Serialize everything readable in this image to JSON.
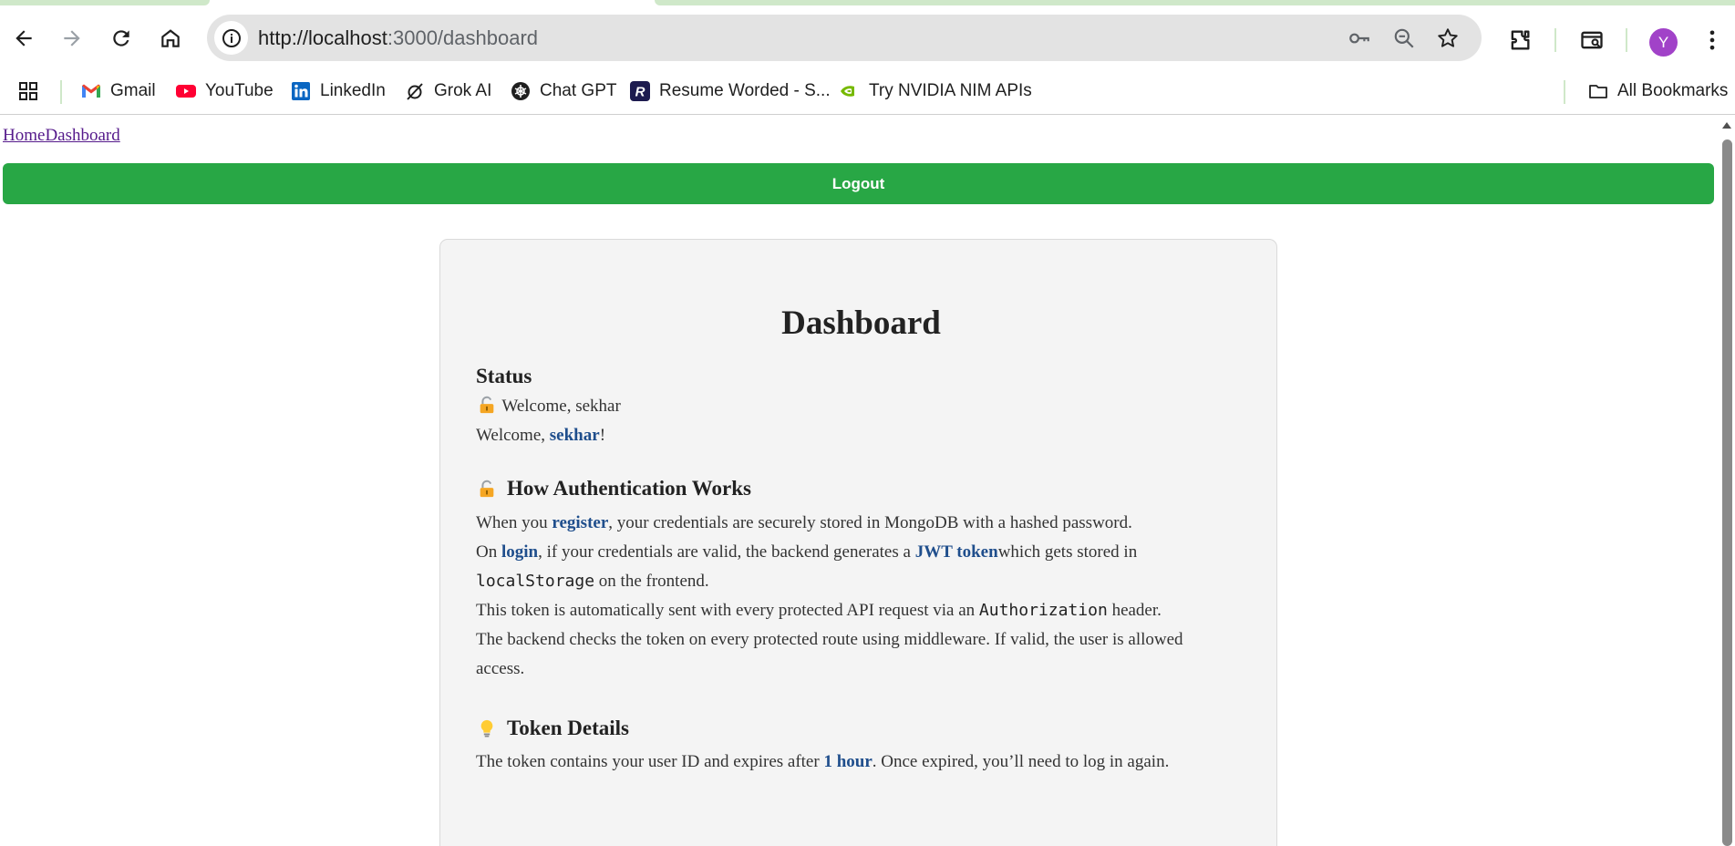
{
  "browser": {
    "url_host": "http://localhost",
    "url_path": ":3000/dashboard",
    "avatar_letter": "Y",
    "accent_color": "#cfe8c9",
    "avatar_color": "#a142c8"
  },
  "bookmarks": {
    "items": [
      {
        "label": "Gmail",
        "icon": "gmail-icon"
      },
      {
        "label": "YouTube",
        "icon": "youtube-icon"
      },
      {
        "label": "LinkedIn",
        "icon": "linkedin-icon"
      },
      {
        "label": "Grok AI",
        "icon": "grok-icon"
      },
      {
        "label": "Chat GPT",
        "icon": "chatgpt-icon"
      },
      {
        "label": "Resume Worded - S...",
        "icon": "resume-worded-icon"
      },
      {
        "label": "Try NVIDIA NIM APIs",
        "icon": "nvidia-icon"
      }
    ],
    "all_bookmarks": "All Bookmarks"
  },
  "page": {
    "nav": {
      "home": "Home",
      "dashboard": "Dashboard"
    },
    "logout_label": "Logout",
    "logout_color": "#28a745",
    "card": {
      "title": "Dashboard",
      "status_heading": "Status",
      "status_line": "Welcome, sekhar",
      "welcome_prefix": "Welcome, ",
      "welcome_name": "sekhar",
      "welcome_suffix": "!",
      "auth_heading": "How Authentication Works",
      "p1_a": "When you ",
      "p1_b": "register",
      "p1_c": ", your credentials are securely stored in MongoDB with a hashed password.",
      "p2_a": "On ",
      "p2_b": "login",
      "p2_c": ", if your credentials are valid, the backend generates a ",
      "p2_d": "JWT token",
      "p2_e": "which gets stored in",
      "p3_a": "localStorage",
      "p3_b": " on the frontend.",
      "p4_a": "This token is automatically sent with every protected API request via an ",
      "p4_b": "Authorization",
      "p4_c": " header.",
      "p5": "The backend checks the token on every protected route using middleware. If valid, the user is allowed",
      "p6": "access.",
      "token_heading": "Token Details",
      "t1_a": "The token contains your user ID and expires after ",
      "t1_b": "1 hour",
      "t1_c": ". Once expired, you’ll need to log in again."
    }
  }
}
